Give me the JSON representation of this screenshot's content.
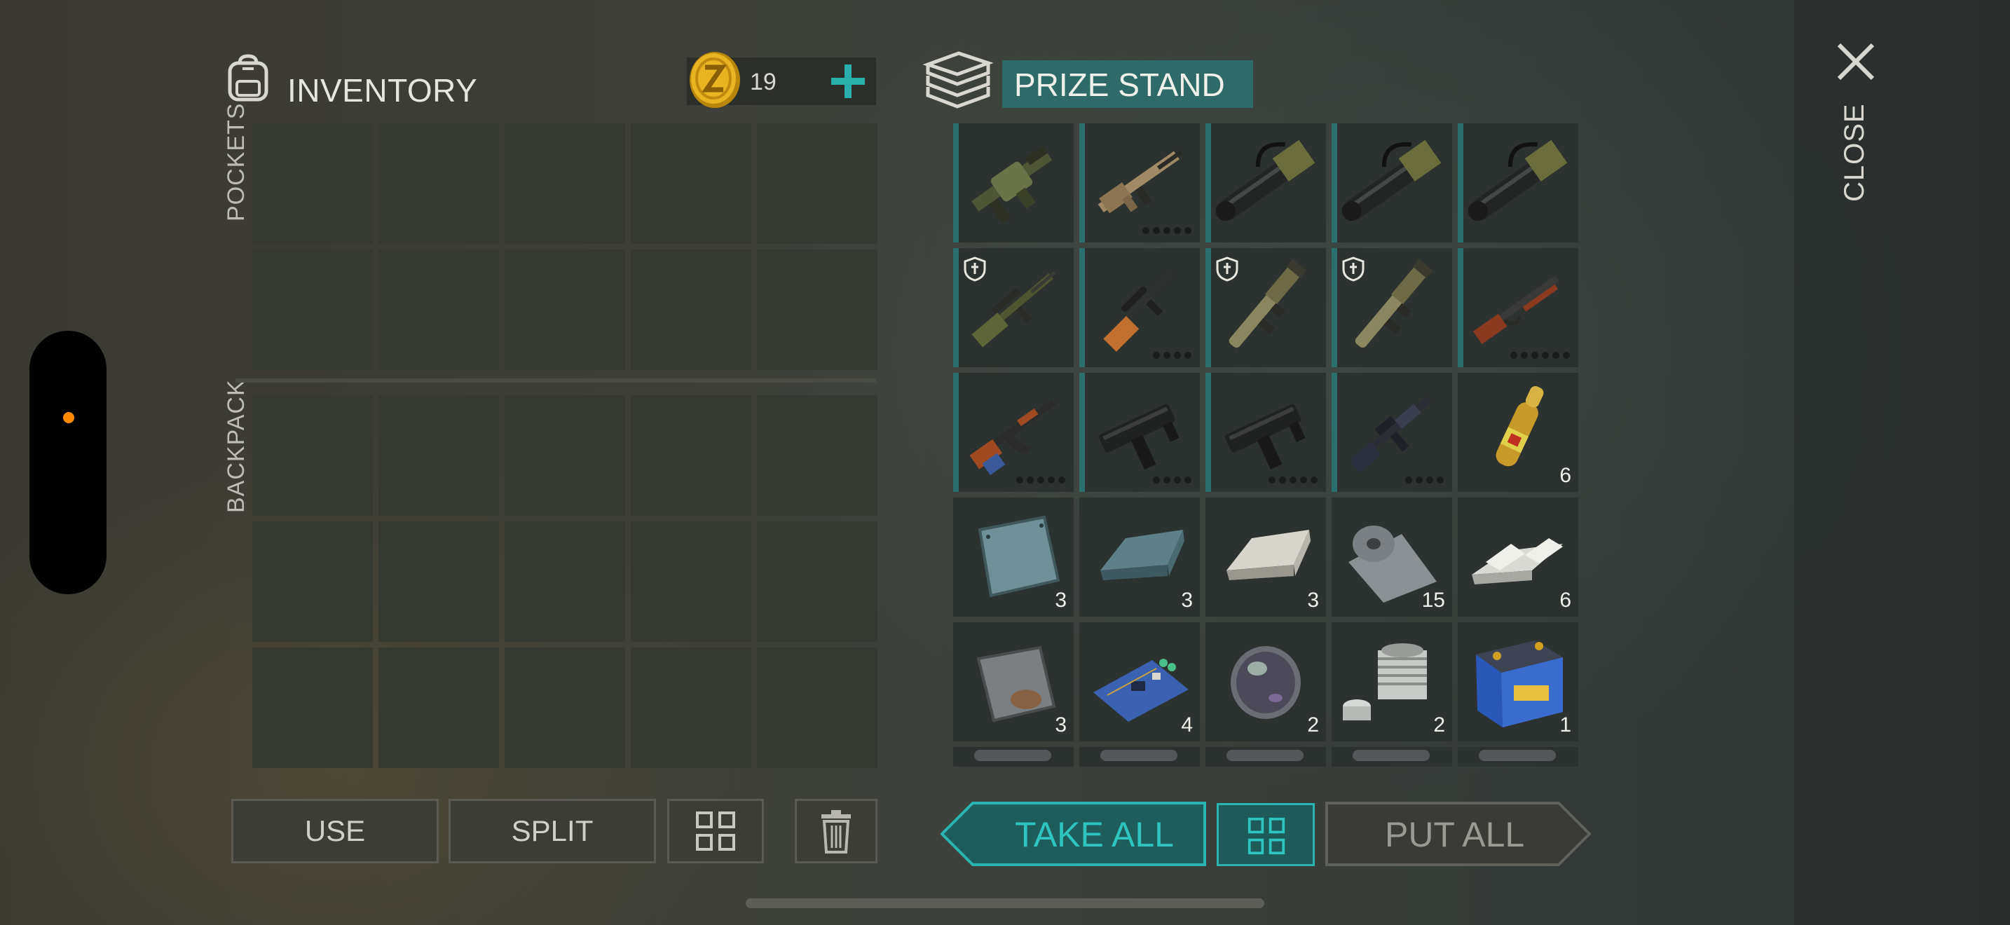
{
  "inventory": {
    "title": "INVENTORY",
    "coins": "19",
    "pockets_label": "POCKETS",
    "backpack_label": "BACKPACK",
    "pocket_slots": 10,
    "backpack_slots": 15
  },
  "stand": {
    "title": "PRIZE STAND",
    "items": [
      {
        "name": "grenade-launcher-icon",
        "weapon": true,
        "count": "",
        "shield": false,
        "mods": 0
      },
      {
        "name": "scar-rifle-icon",
        "weapon": true,
        "count": "",
        "shield": false,
        "mods": 5
      },
      {
        "name": "minigun-icon",
        "weapon": true,
        "count": "",
        "shield": false,
        "mods": 0
      },
      {
        "name": "minigun-icon",
        "weapon": true,
        "count": "",
        "shield": false,
        "mods": 0
      },
      {
        "name": "minigun-icon",
        "weapon": true,
        "count": "",
        "shield": false,
        "mods": 0
      },
      {
        "name": "sniper-rifle-icon",
        "weapon": true,
        "count": "",
        "shield": true,
        "mods": 0
      },
      {
        "name": "scoped-carbine-icon",
        "weapon": true,
        "count": "",
        "shield": false,
        "mods": 4
      },
      {
        "name": "rocket-launcher-icon",
        "weapon": true,
        "count": "",
        "shield": true,
        "mods": 0
      },
      {
        "name": "rocket-launcher-icon",
        "weapon": true,
        "count": "",
        "shield": true,
        "mods": 0
      },
      {
        "name": "lever-shotgun-icon",
        "weapon": true,
        "count": "",
        "shield": false,
        "mods": 6
      },
      {
        "name": "ak-rifle-icon",
        "weapon": true,
        "count": "",
        "shield": false,
        "mods": 5
      },
      {
        "name": "uzi-icon",
        "weapon": true,
        "count": "",
        "shield": false,
        "mods": 4
      },
      {
        "name": "uzi-icon",
        "weapon": true,
        "count": "",
        "shield": false,
        "mods": 5
      },
      {
        "name": "m16-rifle-icon",
        "weapon": true,
        "count": "",
        "shield": false,
        "mods": 4
      },
      {
        "name": "ampoule-icon",
        "weapon": false,
        "count": "6",
        "shield": false,
        "mods": 0
      },
      {
        "name": "steel-plate-icon",
        "weapon": false,
        "count": "3",
        "shield": false,
        "mods": 0
      },
      {
        "name": "steel-ingot-icon",
        "weapon": false,
        "count": "3",
        "shield": false,
        "mods": 0
      },
      {
        "name": "silver-ingot-icon",
        "weapon": false,
        "count": "3",
        "shield": false,
        "mods": 0
      },
      {
        "name": "metal-roll-icon",
        "weapon": false,
        "count": "15",
        "shield": false,
        "mods": 0
      },
      {
        "name": "aluminum-bars-icon",
        "weapon": false,
        "count": "6",
        "shield": false,
        "mods": 0
      },
      {
        "name": "rusty-plate-icon",
        "weapon": false,
        "count": "3",
        "shield": false,
        "mods": 0
      },
      {
        "name": "circuit-board-icon",
        "weapon": false,
        "count": "4",
        "shield": false,
        "mods": 0
      },
      {
        "name": "lens-icon",
        "weapon": false,
        "count": "2",
        "shield": false,
        "mods": 0
      },
      {
        "name": "engine-cylinder-icon",
        "weapon": false,
        "count": "2",
        "shield": false,
        "mods": 0
      },
      {
        "name": "car-battery-icon",
        "weapon": false,
        "count": "1",
        "shield": false,
        "mods": 0
      },
      {
        "name": "partial-item-icon",
        "weapon": false,
        "count": "",
        "shield": false,
        "mods": 0
      },
      {
        "name": "partial-item-icon",
        "weapon": false,
        "count": "",
        "shield": false,
        "mods": 0
      },
      {
        "name": "partial-item-icon",
        "weapon": false,
        "count": "",
        "shield": false,
        "mods": 0
      },
      {
        "name": "partial-item-icon",
        "weapon": false,
        "count": "",
        "shield": false,
        "mods": 0
      },
      {
        "name": "partial-item-icon",
        "weapon": false,
        "count": "",
        "shield": false,
        "mods": 0
      }
    ]
  },
  "buttons": {
    "use": "USE",
    "split": "SPLIT",
    "take_all": "TAKE ALL",
    "put_all": "PUT ALL",
    "close": "CLOSE"
  },
  "colors": {
    "accent": "#2ec4c0",
    "accent_dark": "#2e6b68",
    "cell": "#373a33",
    "stand_cell": "#2c3230",
    "indicator": "#ff8a00"
  }
}
